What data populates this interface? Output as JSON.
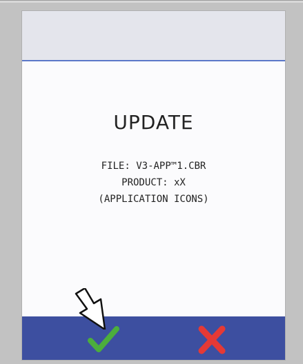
{
  "screen": {
    "title": "UPDATE",
    "file_line": "FILE: V3-APP™1.CBR",
    "product_line": "PRODUCT: xX",
    "icons_line": "(APPLICATION ICONS)"
  },
  "footer": {
    "confirm_icon": "check-icon",
    "cancel_icon": "close-icon"
  },
  "colors": {
    "background": "#c2c2c2",
    "screen": "#fbfbfd",
    "header_band": "#e4e5ec",
    "header_rule": "#5a77c8",
    "footer_bar": "#3d4fa0",
    "confirm": "#4cae3c",
    "cancel": "#e53935"
  }
}
